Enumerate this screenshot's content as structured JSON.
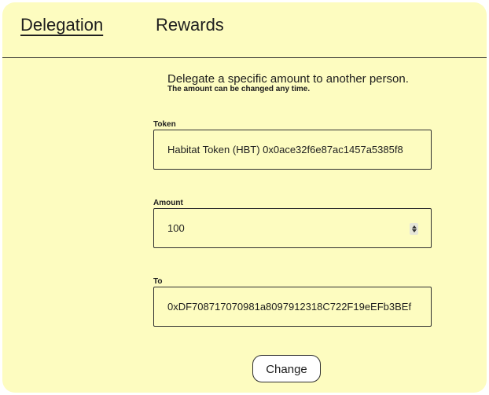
{
  "tabs": {
    "delegation": "Delegation",
    "rewards": "Rewards"
  },
  "intro": {
    "title": "Delegate a specific amount to another person.",
    "subtitle": "The amount can be changed any time."
  },
  "fields": {
    "token": {
      "label": "Token",
      "value": "Habitat Token (HBT) 0x0ace32f6e87ac1457a5385f8"
    },
    "amount": {
      "label": "Amount",
      "value": "100"
    },
    "to": {
      "label": "To",
      "value": "0xDF708717070981a8097912318C722F19eEFb3BEf"
    }
  },
  "actions": {
    "change_label": "Change"
  },
  "colors": {
    "panel_background": "#fdfcc0",
    "text": "#1c1c1c",
    "border": "#2f2f2f",
    "button_background": "#ffffff"
  }
}
